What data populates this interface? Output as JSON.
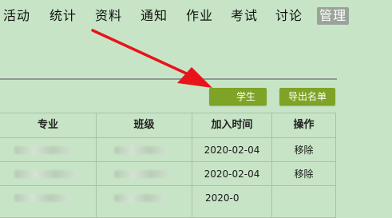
{
  "nav": {
    "items": [
      {
        "label": "活动"
      },
      {
        "label": "统计"
      },
      {
        "label": "资料"
      },
      {
        "label": "通知"
      },
      {
        "label": "作业"
      },
      {
        "label": "考试"
      },
      {
        "label": "讨论"
      },
      {
        "label": "管理",
        "active": true
      }
    ]
  },
  "toolbar": {
    "add_student_label": "学生",
    "export_label": "导出名单"
  },
  "table": {
    "headers": [
      "专业",
      "班级",
      "加入时间",
      "操作"
    ],
    "rows": [
      {
        "join_time": "2020-02-04",
        "action": "移除"
      },
      {
        "join_time": "2020-02-04",
        "action": "移除"
      },
      {
        "join_time": "2020-0",
        "action": ""
      }
    ]
  },
  "colors": {
    "background": "#c7e5c6",
    "button": "#7ea326",
    "active_tab": "#9aa39a",
    "arrow": "#e8131b"
  },
  "annotation": {
    "icon": "red-arrow-icon"
  }
}
